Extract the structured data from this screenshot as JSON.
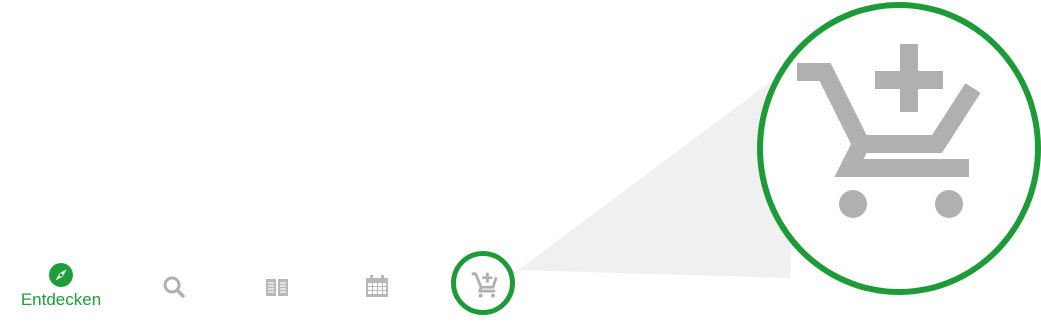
{
  "bottom_nav": {
    "items": [
      {
        "id": "discover",
        "label": "Entdecken",
        "icon": "compass-icon",
        "active": true
      },
      {
        "id": "search",
        "label": "",
        "icon": "search-icon",
        "active": false
      },
      {
        "id": "book",
        "label": "",
        "icon": "book-icon",
        "active": false
      },
      {
        "id": "calendar",
        "label": "",
        "icon": "calendar-icon",
        "active": false
      },
      {
        "id": "cart",
        "label": "",
        "icon": "add-to-cart-icon",
        "active": false
      }
    ]
  },
  "colors": {
    "accent": "#1f9d3a",
    "highlight_ring": "#1e9a38",
    "icon_inactive": "#b0b0b0",
    "cone": "#efefef"
  }
}
